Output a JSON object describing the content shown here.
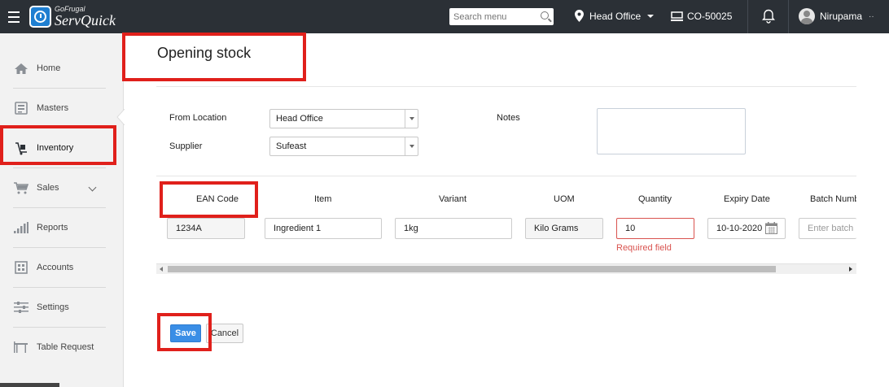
{
  "brand": {
    "small": "GoFrugal",
    "big": "ServQuick"
  },
  "topbar": {
    "search_placeholder": "Search menu",
    "location": "Head Office",
    "counter": "CO-50025",
    "user": "Nirupama",
    "more": "··"
  },
  "sidebar": {
    "items": [
      {
        "label": "Home",
        "icon": "home-icon"
      },
      {
        "label": "Masters",
        "icon": "masters-icon"
      },
      {
        "label": "Inventory",
        "icon": "inventory-icon"
      },
      {
        "label": "Sales",
        "icon": "cart-icon"
      },
      {
        "label": "Reports",
        "icon": "bar-chart-icon"
      },
      {
        "label": "Accounts",
        "icon": "accounts-icon"
      },
      {
        "label": "Settings",
        "icon": "sliders-icon"
      },
      {
        "label": "Table Request",
        "icon": "table-icon"
      }
    ],
    "active": "Inventory"
  },
  "page": {
    "title": "Opening stock",
    "from_location_label": "From Location",
    "from_location_value": "Head Office",
    "supplier_label": "Supplier",
    "supplier_value": "Sufeast",
    "notes_label": "Notes",
    "notes_value": ""
  },
  "table": {
    "headers": [
      "EAN Code",
      "Item",
      "Variant",
      "UOM",
      "Quantity",
      "Expiry Date",
      "Batch Numb"
    ],
    "row": {
      "ean": "1234A",
      "item": "Ingredient 1",
      "variant": "1kg",
      "uom": "Kilo Grams",
      "quantity": "10",
      "expiry": "10-10-2020",
      "batch_placeholder": "Enter batch n"
    },
    "quantity_error": "Required field"
  },
  "actions": {
    "save": "Save",
    "cancel": "Cancel"
  },
  "colors": {
    "topbar": "#2b3036",
    "accent": "#3a8ee6",
    "highlight": "#e0201b",
    "error": "#d9534f"
  }
}
